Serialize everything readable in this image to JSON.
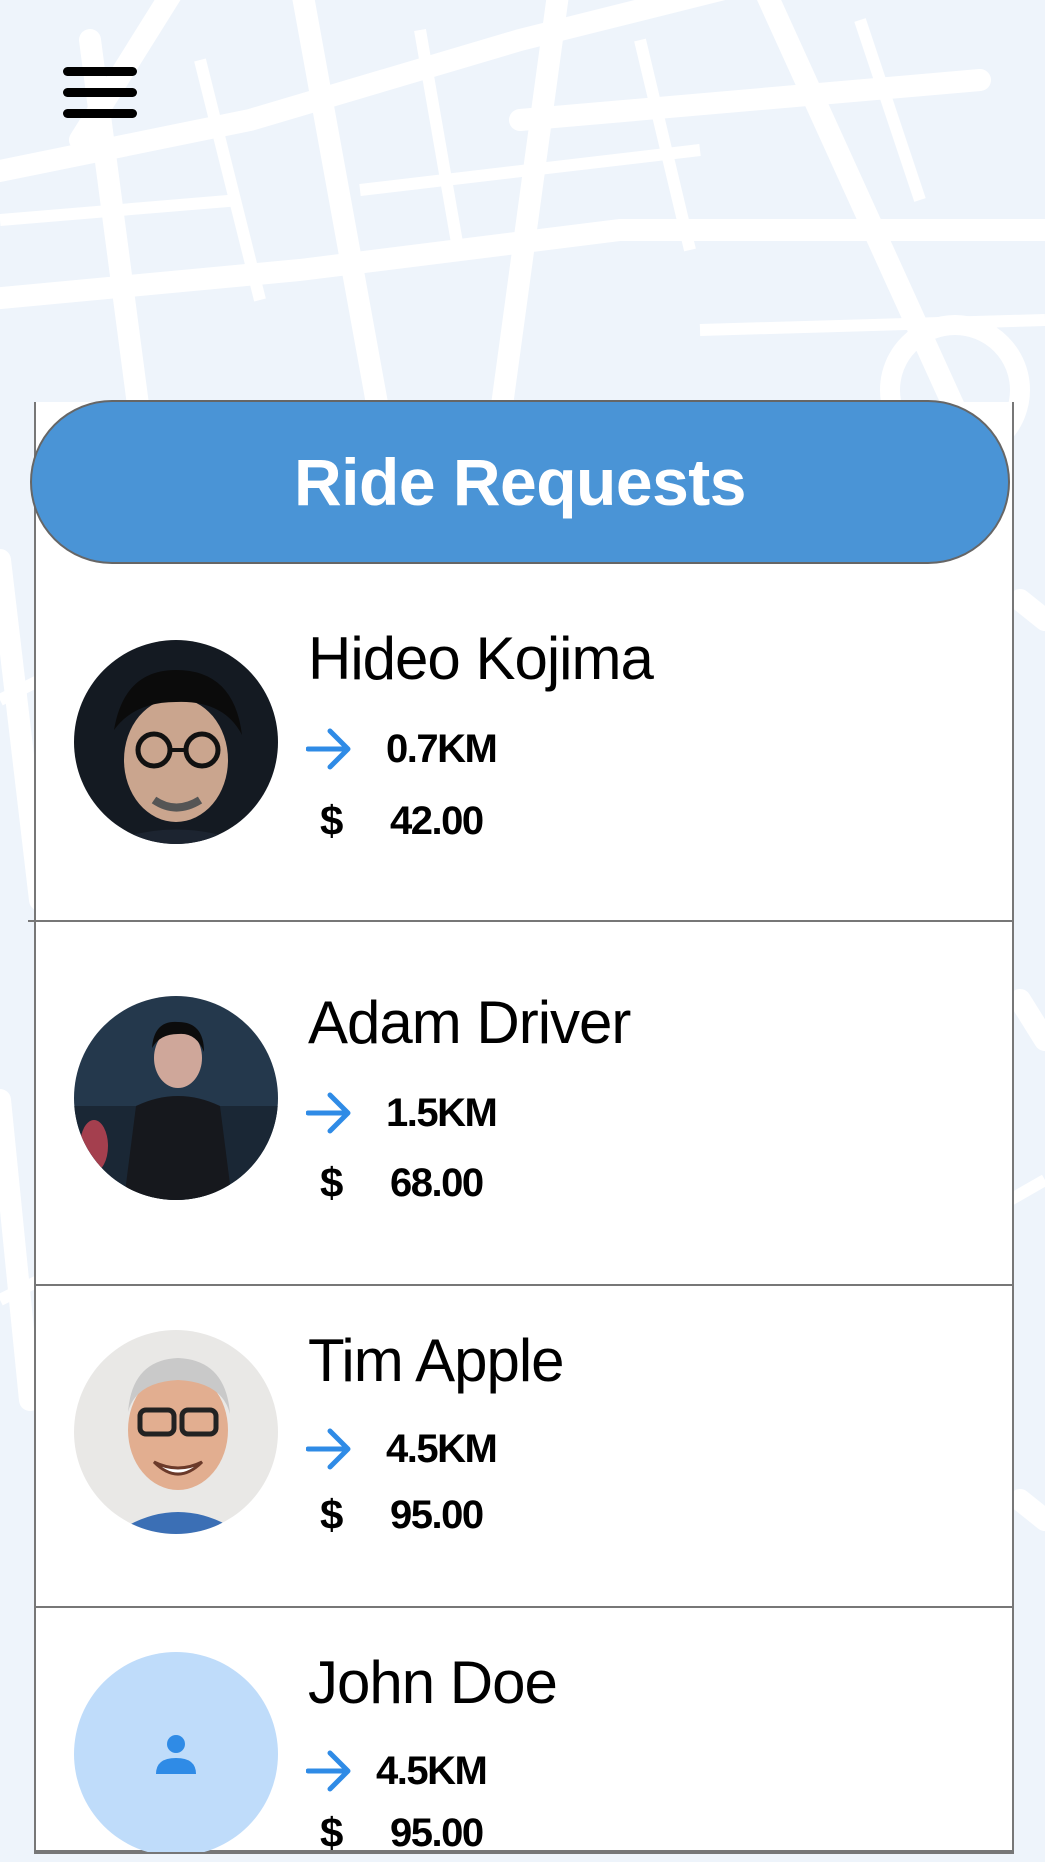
{
  "header": {
    "title": "Ride Requests"
  },
  "requests": [
    {
      "name": "Hideo Kojima",
      "distance": "0.7KM",
      "currency": "$",
      "price": "42.00",
      "avatar": "photo"
    },
    {
      "name": "Adam Driver",
      "distance": "1.5KM",
      "currency": "$",
      "price": "68.00",
      "avatar": "photo"
    },
    {
      "name": "Tim Apple",
      "distance": "4.5KM",
      "currency": "$",
      "price": "95.00",
      "avatar": "photo"
    },
    {
      "name": "John Doe",
      "distance": "4.5KM",
      "currency": "$",
      "price": "95.00",
      "avatar": "person-icon"
    }
  ],
  "icons": {
    "menu": "hamburger-menu-icon",
    "distance": "arrow-right-icon",
    "price": "dollar-icon",
    "placeholder": "person-icon"
  },
  "colors": {
    "accent": "#4a94d6",
    "arrow": "#2f8be6",
    "placeholder_bg": "#bfdcfa",
    "placeholder_icon": "#2f8be6",
    "map_bg": "#eef4fb"
  }
}
